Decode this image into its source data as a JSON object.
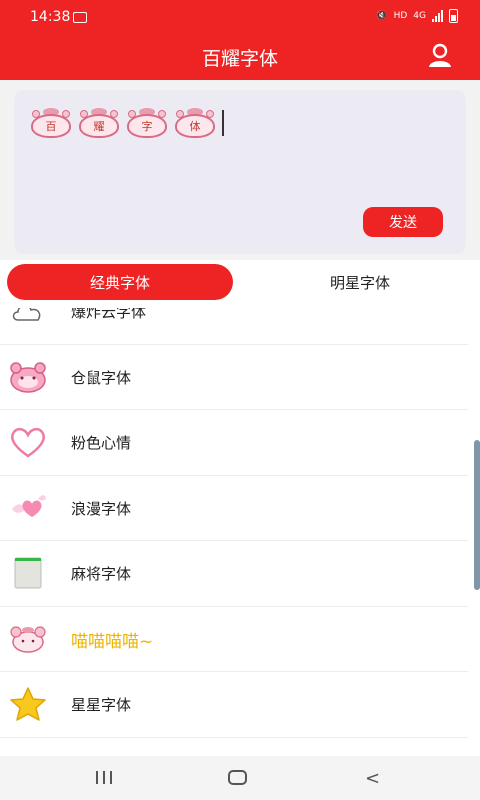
{
  "status_bar": {
    "time": "14:38",
    "network_hd": "HD",
    "network_4g": "4G"
  },
  "app_bar": {
    "title": "百耀字体"
  },
  "editor": {
    "preview_chars": [
      "百",
      "耀",
      "字",
      "体"
    ],
    "send_label": "发送"
  },
  "tabs": [
    {
      "label": "经典字体",
      "active": true
    },
    {
      "label": "明星字体",
      "active": false
    }
  ],
  "font_list": [
    {
      "label": "爆炸云字体",
      "icon": "cloud-icon"
    },
    {
      "label": "仓鼠字体",
      "icon": "hamster-icon"
    },
    {
      "label": "粉色心情",
      "icon": "pink-heart-icon"
    },
    {
      "label": "浪漫字体",
      "icon": "winged-heart-icon"
    },
    {
      "label": "麻将字体",
      "icon": "mahjong-tile-icon"
    },
    {
      "label": "喵喵喵喵~",
      "icon": "cat-icon"
    },
    {
      "label": "星星字体",
      "icon": "star-icon"
    }
  ],
  "colors": {
    "accent": "#ee2424",
    "fancy_text": "#f0b400"
  }
}
